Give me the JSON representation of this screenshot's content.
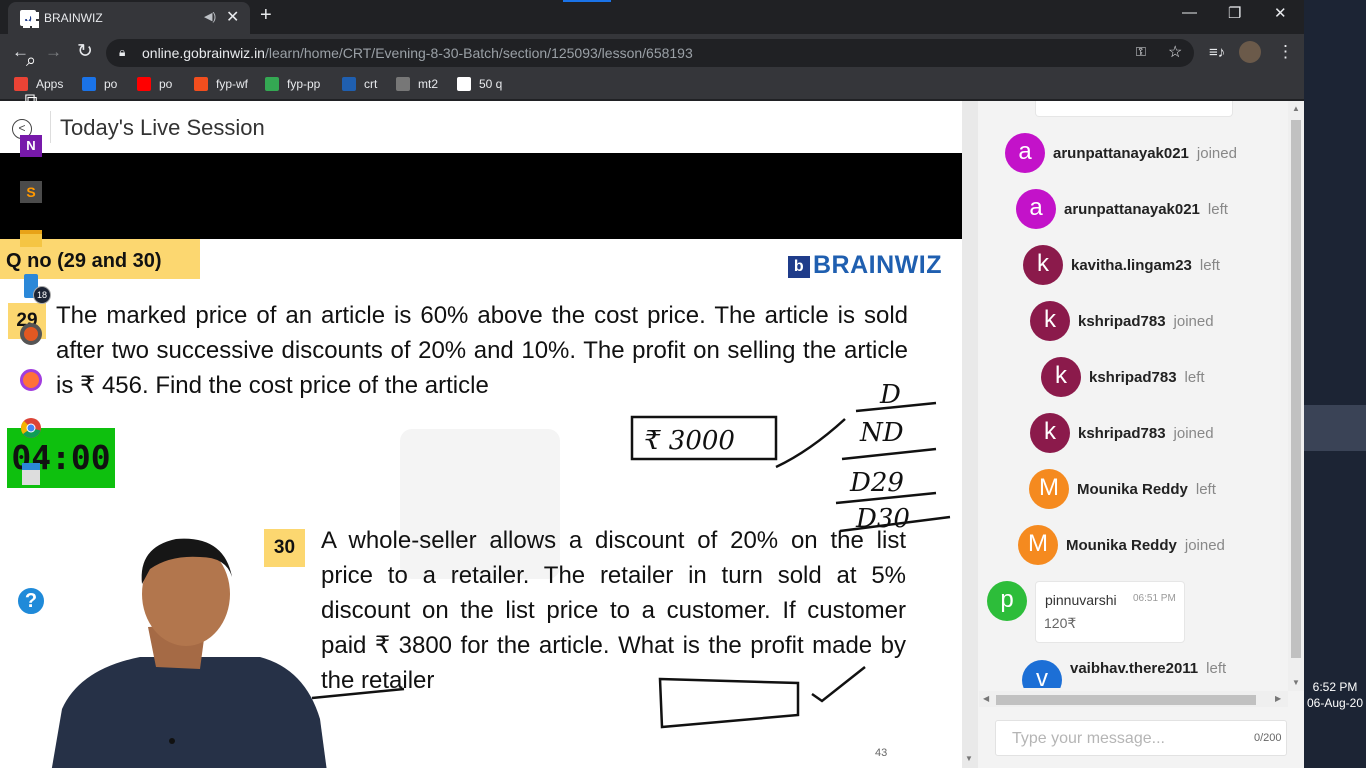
{
  "browser": {
    "tab_title": "BRAINWIZ",
    "tab_favicon": "b",
    "url_host": "online.gobrainwiz.in",
    "url_path": "/learn/home/CRT/Evening-8-30-Batch/section/125093/lesson/658193",
    "bookmarks": [
      {
        "label": "Apps",
        "icon": "apps-grid-icon",
        "color": "#ea4335"
      },
      {
        "label": "po",
        "icon": "po-icon",
        "color": "#1a73e8"
      },
      {
        "label": "po",
        "icon": "youtube-icon",
        "color": "#ff0000"
      },
      {
        "label": "fyp-wf",
        "icon": "figma-icon",
        "color": "#f24e1e"
      },
      {
        "label": "fyp-pp",
        "icon": "pp-icon",
        "color": "#34a853"
      },
      {
        "label": "crt",
        "icon": "brainwiz-icon",
        "color": "#1f5fb0"
      },
      {
        "label": "mt2",
        "icon": "cc-icon",
        "color": "#777777"
      },
      {
        "label": "50 q",
        "icon": "globe-icon",
        "color": "#ffffff"
      }
    ]
  },
  "header": {
    "title": "Today's Live Session"
  },
  "slide": {
    "qno": "Q no (29 and 30)",
    "brand": "BRAINWIZ",
    "q29_num": "29",
    "q29_text": "The marked price of an article is 60% above the cost price. The article is sold after two successive discounts of 20% and 10%. The profit on selling the article is ₹ 456. Find the cost price of the article",
    "q30_num": "30",
    "q30_text": "A whole-seller allows a discount of 20% on the list price to a retailer. The retailer in turn sold at 5% discount on the list price to a customer. If customer paid ₹ 3800 for the article. What is the profit made by the retailer",
    "timer": "04:00",
    "page_number": "43",
    "handwriting": [
      "₹ 3000",
      "D",
      "ND",
      "D29",
      "D30"
    ]
  },
  "chat": {
    "events": [
      {
        "initial": "a",
        "color": "#c312c9",
        "name": "arunpattanayak021",
        "action": "joined"
      },
      {
        "initial": "a",
        "color": "#c312c9",
        "name": "arunpattanayak021",
        "action": "left"
      },
      {
        "initial": "k",
        "color": "#8b1a4b",
        "name": "kavitha.lingam23",
        "action": "left"
      },
      {
        "initial": "k",
        "color": "#8b1a4b",
        "name": "kshripad783",
        "action": "joined"
      },
      {
        "initial": "k",
        "color": "#8b1a4b",
        "name": "kshripad783",
        "action": "left"
      },
      {
        "initial": "k",
        "color": "#8b1a4b",
        "name": "kshripad783",
        "action": "joined"
      },
      {
        "initial": "M",
        "color": "#f58a1f",
        "name": "Mounika Reddy",
        "action": "left"
      },
      {
        "initial": "M",
        "color": "#f58a1f",
        "name": "Mounika Reddy",
        "action": "joined"
      }
    ],
    "message": {
      "initial": "p",
      "color": "#2dbd3a",
      "name": "pinnuvarshi",
      "time": "06:51 PM",
      "text": "120₹"
    },
    "last_event": {
      "initial": "v",
      "color": "#1c6fd6",
      "name": "vaibhav.there2011",
      "action": "left"
    },
    "input_placeholder": "Type your message...",
    "char_count": "0/200"
  },
  "taskbar": {
    "time": "6:52 PM",
    "date": "06-Aug-20",
    "badge": "18"
  }
}
